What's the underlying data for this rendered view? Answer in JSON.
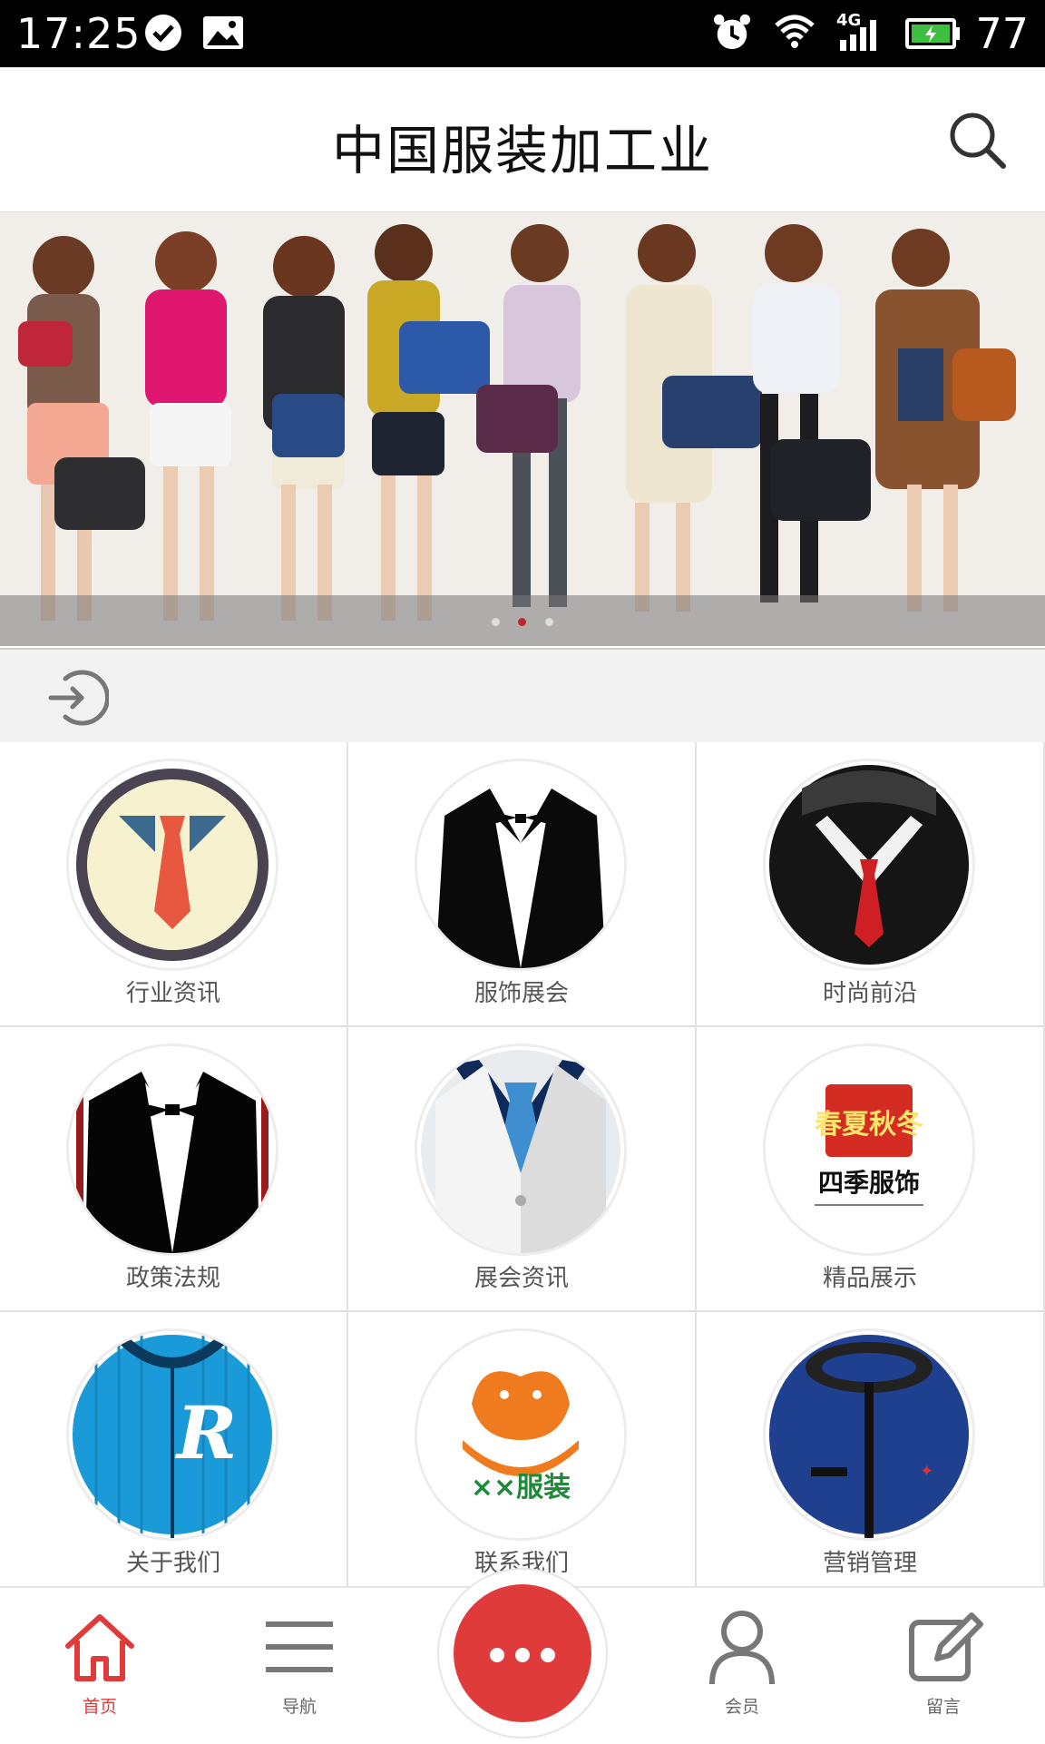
{
  "status_bar": {
    "time": "17:25",
    "battery_percent": "77",
    "network": "4G",
    "icons": [
      "check-circle-icon",
      "image-icon",
      "alarm-icon",
      "wifi-icon",
      "signal-icon",
      "battery-icon"
    ]
  },
  "header": {
    "title": "中国服装加工业",
    "search_icon": "search-icon"
  },
  "banner": {
    "slide_count": 3,
    "active_slide": 2,
    "active_dot_color": "#c0262b"
  },
  "login_bar": {
    "icon": "login-arrow-icon"
  },
  "grid": {
    "items": [
      {
        "label": "行业资讯",
        "icon": "tie-icon"
      },
      {
        "label": "服饰展会",
        "icon": "tuxedo-icon"
      },
      {
        "label": "时尚前沿",
        "icon": "suit-collar-icon"
      },
      {
        "label": "政策法规",
        "icon": "bowtie-tuxedo-icon"
      },
      {
        "label": "展会资讯",
        "icon": "white-coat-icon"
      },
      {
        "label": "精品展示",
        "icon": "four-seasons-logo-icon",
        "logo_text": "四季服饰",
        "seal_text": "春夏秋冬"
      },
      {
        "label": "关于我们",
        "icon": "jersey-icon"
      },
      {
        "label": "联系我们",
        "icon": "fashion-logo-icon",
        "logo_text": "××服装"
      },
      {
        "label": "营销管理",
        "icon": "jacket-zipper-icon"
      }
    ]
  },
  "bottom_nav": {
    "items": [
      {
        "label": "首页",
        "icon": "home-icon",
        "active": true
      },
      {
        "label": "导航",
        "icon": "menu-icon",
        "active": false
      },
      {
        "label": "",
        "icon": "more-dots-icon",
        "active": false
      },
      {
        "label": "会员",
        "icon": "user-icon",
        "active": false
      },
      {
        "label": "留言",
        "icon": "edit-icon",
        "active": false
      }
    ],
    "accent_color": "#e03b3b"
  }
}
